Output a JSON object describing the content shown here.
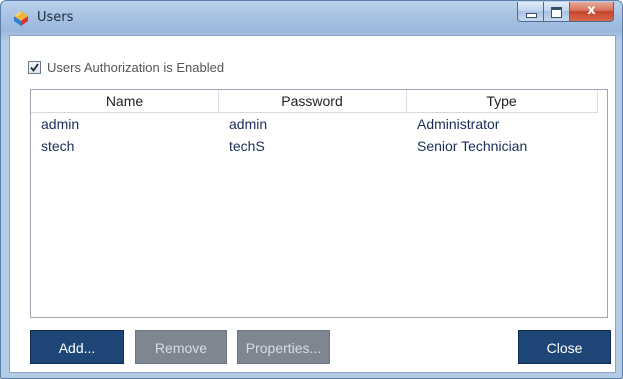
{
  "window": {
    "title": "Users",
    "app_icon": "app-icon",
    "controls": [
      "minimize-icon",
      "maximize-icon",
      "close-icon"
    ],
    "close_glyph": "x"
  },
  "auth": {
    "checked": true,
    "label": "Users Authorization is Enabled"
  },
  "table": {
    "columns": [
      "Name",
      "Password",
      "Type"
    ],
    "rows": [
      {
        "name": "admin",
        "password": "admin",
        "type": "Administrator"
      },
      {
        "name": "stech",
        "password": "techS",
        "type": "Senior Technician"
      }
    ]
  },
  "buttons": {
    "add": "Add...",
    "remove": "Remove",
    "properties": "Properties...",
    "close": "Close"
  },
  "colors": {
    "primary_button": "#1e4677",
    "disabled_button": "#7e8791",
    "row_text": "#1a2d57"
  }
}
